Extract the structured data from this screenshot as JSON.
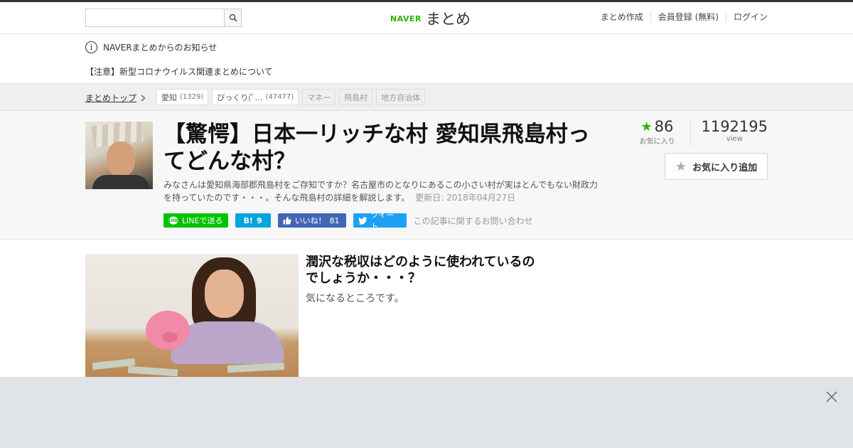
{
  "header": {
    "search_placeholder": "",
    "logo_naver": "NAVER",
    "logo_matome": "まとめ",
    "links": [
      "まとめ作成",
      "会員登録 (無料)",
      "ログイン"
    ]
  },
  "notice": {
    "heading": "NAVERまとめからのお知らせ",
    "item": "【注意】新型コロナウイルス関連まとめについて"
  },
  "breadcrumb": {
    "top": "まとめトップ",
    "tags": [
      {
        "label": "愛知",
        "count": "(1329)"
      },
      {
        "label": "びっくり(ﾟ…",
        "count": "(47477)"
      },
      {
        "label": "マネー",
        "count": ""
      },
      {
        "label": "飛島村",
        "count": ""
      },
      {
        "label": "地方自治体",
        "count": ""
      }
    ]
  },
  "article": {
    "title": "【驚愕】日本一リッチな村 愛知県飛島村ってどんな村？",
    "description": "みなさんは愛知県海部郡飛島村をご存知ですか？名古屋市のとなりにあるこの小さい村が実はとんでもない財政力を持っていたのです・・・。そんな飛島村の詳細を解説します。",
    "updated": "更新日: 2018年04月27日",
    "favorites": "86",
    "favorites_label": "お気に入り",
    "views": "1192195",
    "views_label": "view",
    "fav_button": "お気に入り追加",
    "share": {
      "line": "LINEで送る",
      "hatena_label": "B!",
      "hatena_count": "9",
      "fb_label": "いいね！",
      "fb_count": "81",
      "tweet": "ツイート",
      "inquiry": "この記事に関するお問い合わせ"
    }
  },
  "content": {
    "heading": "潤沢な税収はどのように使われているのでしょうか・・・？",
    "subtext": "気になるところです。"
  },
  "colors": {
    "brand": "#2db400",
    "line": "#00c300",
    "hatena": "#00a4de",
    "facebook": "#4267b2",
    "twitter": "#1da1f2"
  }
}
